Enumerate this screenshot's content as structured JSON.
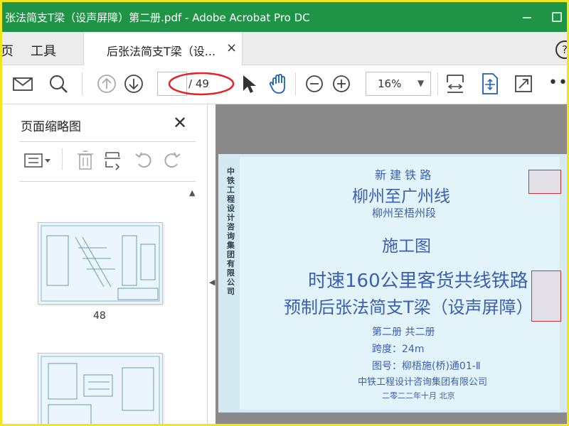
{
  "window": {
    "title": "张法简支T梁（设声屏障）第二册.pdf - Adobe Acrobat Pro DC",
    "title_color": "#1f9447"
  },
  "tabs": {
    "left_fragment": "页",
    "tools": "工具",
    "doc": "后张法简支T梁（设...",
    "close": "×",
    "help": "?"
  },
  "toolbar": {
    "page_total": "/ 49",
    "zoom": "16%",
    "more": "•••",
    "icons": [
      "mail-icon",
      "search-icon",
      "page-up-icon",
      "page-down-icon",
      "select-cursor-icon",
      "hand-tool-icon",
      "zoom-out-icon",
      "zoom-in-icon",
      "fit-width-icon",
      "fit-page-icon",
      "fullscreen-icon"
    ]
  },
  "sidepanel": {
    "title": "页面缩略图",
    "close": "✕",
    "thumbs": [
      {
        "label": "48"
      },
      {
        "label": ""
      }
    ]
  },
  "document": {
    "side_text": "中铁工程设计咨询集团有限公司",
    "line1": "新 建 铁 路",
    "line2": "柳州至广州线",
    "line3": "柳州至梧州段",
    "line4": "施工图",
    "line5": "时速160公里客货共线铁路",
    "line6": "预制后张法简支T梁（设声屏障）",
    "line7": "第二册  共二册",
    "line8": "跨度：24m",
    "line9": "图号：柳梧施(桥)通01-Ⅱ",
    "line10": "中铁工程设计咨询集团有限公司",
    "line11": "二零二二年十月   北京"
  }
}
